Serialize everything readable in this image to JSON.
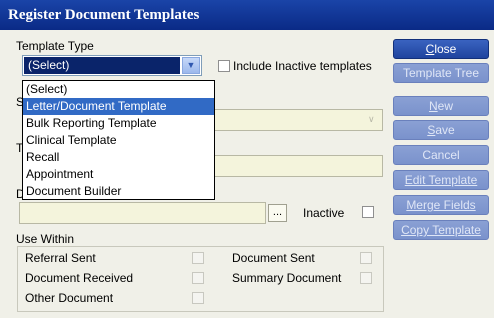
{
  "window": {
    "title": "Register Document Templates"
  },
  "template_type": {
    "label": "Template Type",
    "selected": "(Select)",
    "options": [
      "(Select)",
      "Letter/Document Template",
      "Bulk Reporting Template",
      "Clinical Template",
      "Recall",
      "Appointment",
      "Document Builder"
    ],
    "highlighted": "Letter/Document Template"
  },
  "include_inactive": {
    "label": "Include Inactive templates",
    "checked": false
  },
  "hidden_labels": {
    "s": "S",
    "t": "T",
    "d": "D"
  },
  "browse_label": "...",
  "inactive_label": "Inactive",
  "use_within": {
    "label": "Use Within",
    "items": [
      {
        "label": "Referral Sent"
      },
      {
        "label": "Document Sent"
      },
      {
        "label": "Document Received"
      },
      {
        "label": "Summary Document"
      },
      {
        "label": "Other Document"
      }
    ]
  },
  "buttons": {
    "close_rest": "lose",
    "close_key": "C",
    "template_tree": "Template Tree",
    "new_rest": "ew",
    "new_key": "N",
    "save_rest": "ave",
    "save_key": "S",
    "cancel": "Cancel",
    "edit_template": "Edit Template",
    "merge_fields": "Merge Fields",
    "copy_template": "Copy Template"
  },
  "colors": {
    "title_bar": "#0a2a86",
    "button": "#1f449e",
    "highlight": "#316ac5",
    "panel": "#f0f0e8"
  }
}
